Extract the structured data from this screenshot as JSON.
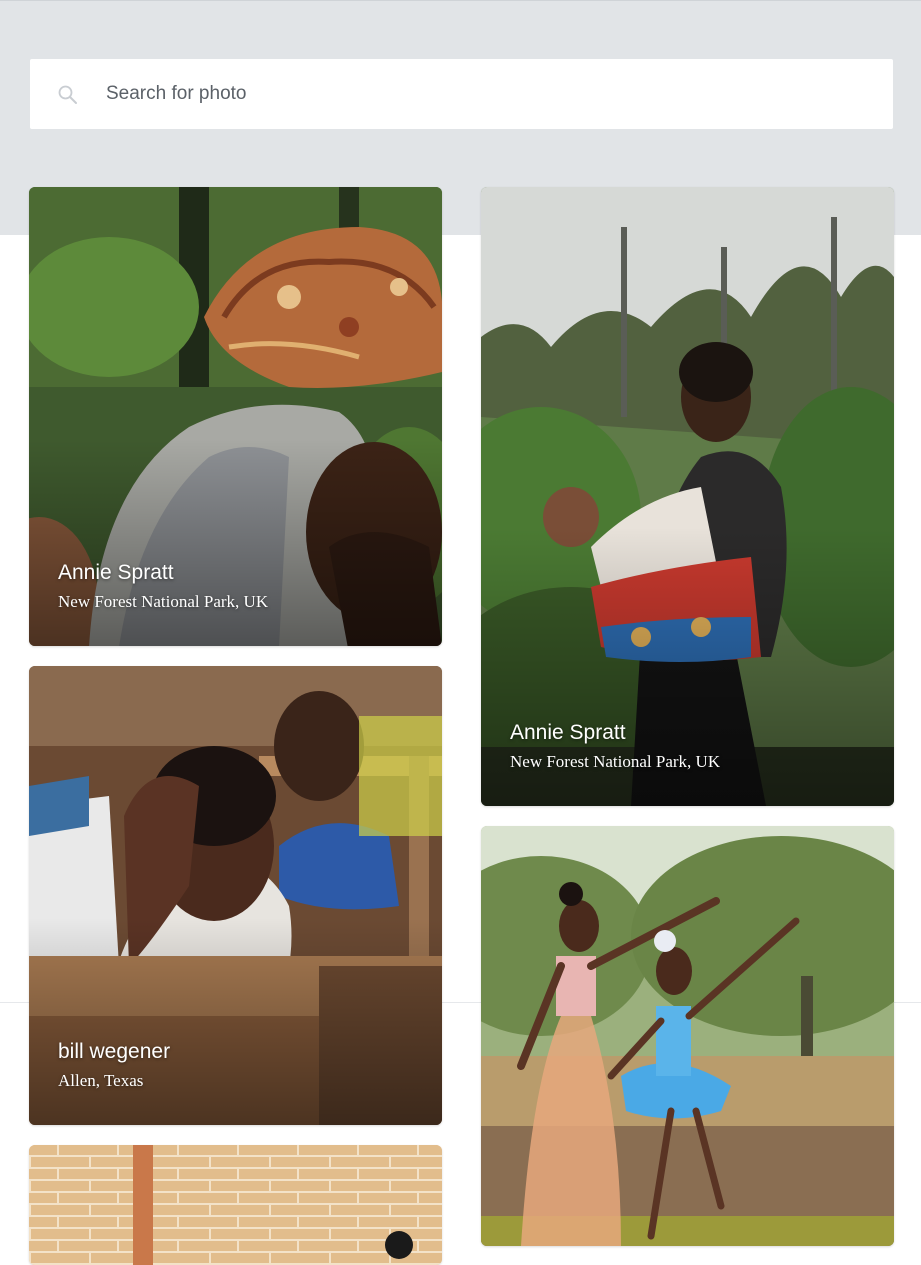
{
  "search": {
    "placeholder": "Search for photo",
    "icon": "search-icon"
  },
  "photos": [
    {
      "author": "Annie Spratt",
      "location": "New Forest National Park, UK"
    },
    {
      "author": "Annie Spratt",
      "location": "New Forest National Park, UK"
    },
    {
      "author": "bill wegener",
      "location": "Allen, Texas"
    }
  ],
  "colors": {
    "page_band": "#e1e4e7",
    "search_background": "#ffffff",
    "caption_text": "#ffffff"
  }
}
